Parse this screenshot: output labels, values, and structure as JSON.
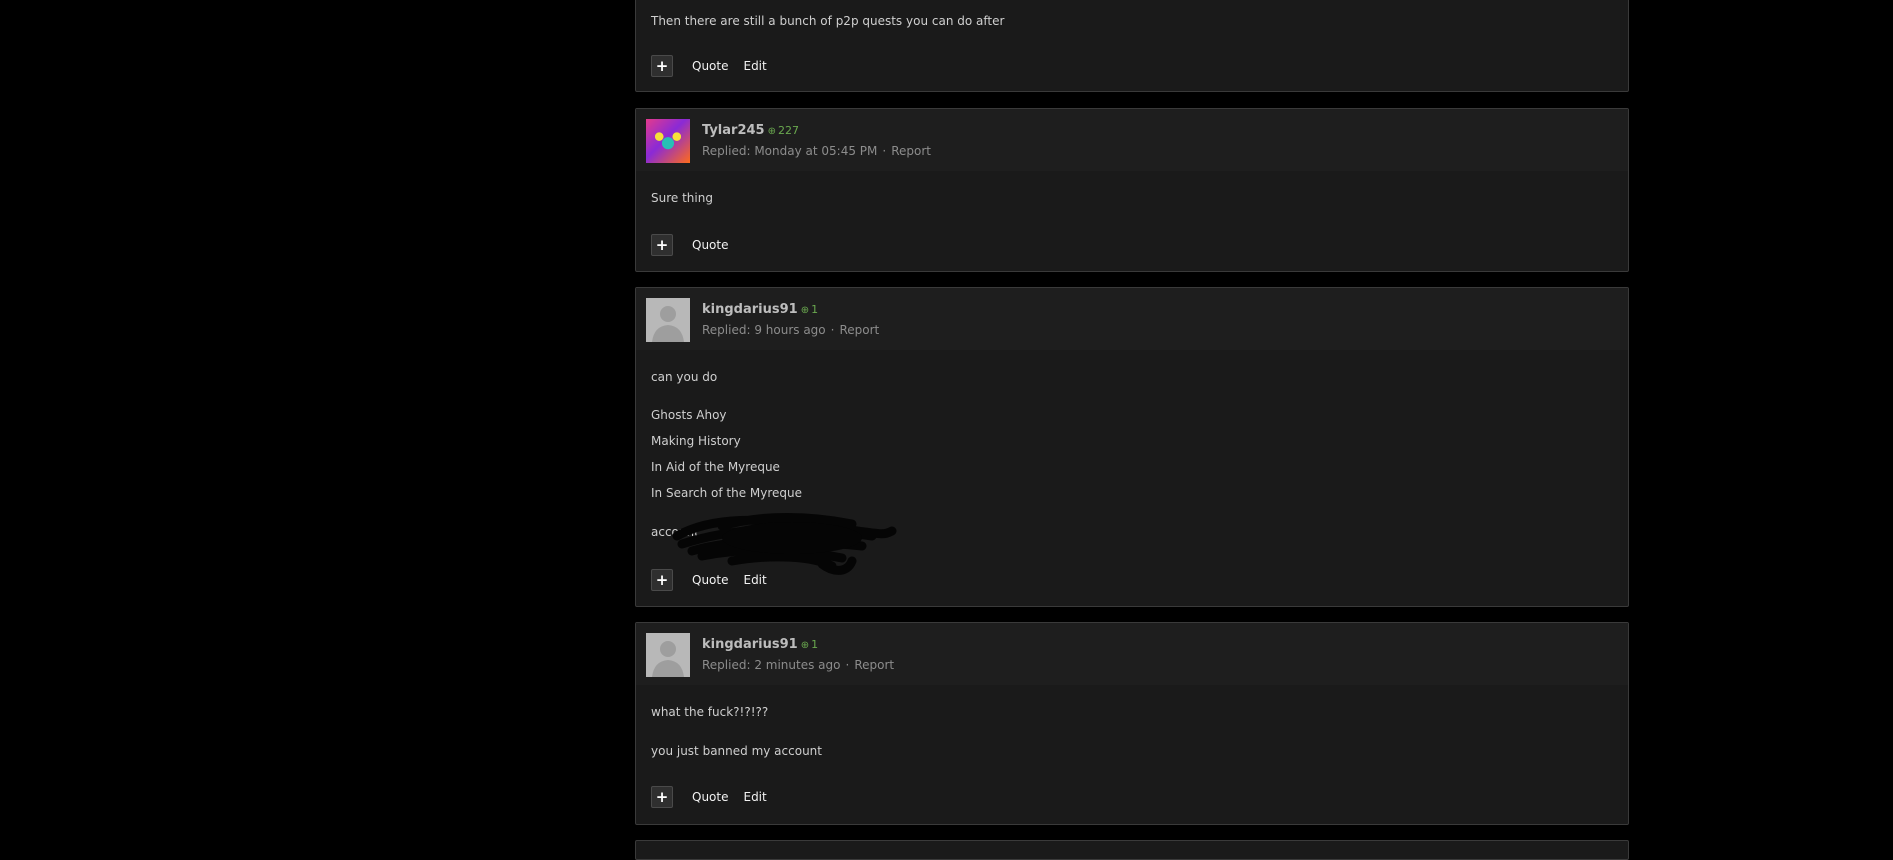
{
  "posts": [
    {
      "body": [
        "Then there are still a bunch of p2p quests you can do after"
      ],
      "actions": {
        "plus": "+",
        "quote": "Quote",
        "edit": "Edit"
      }
    },
    {
      "username": "Tylar245",
      "rep": "227",
      "replied": "Replied:  Monday at 05:45 PM",
      "report": "Report",
      "body": [
        "Sure thing"
      ],
      "actions": {
        "plus": "+",
        "quote": "Quote"
      }
    },
    {
      "username": "kingdarius91",
      "rep": "1",
      "replied": "Replied:  9 hours ago",
      "report": "Report",
      "body": [
        "can you do",
        "Ghosts Ahoy",
        "Making History",
        "In Aid of the Myreque",
        "In Search of the Myreque",
        "account"
      ],
      "actions": {
        "plus": "+",
        "quote": "Quote",
        "edit": "Edit"
      }
    },
    {
      "username": "kingdarius91",
      "rep": "1",
      "replied": "Replied:  2 minutes ago",
      "report": "Report",
      "body": [
        "what the fuck?!?!??",
        "you just banned my account"
      ],
      "actions": {
        "plus": "+",
        "quote": "Quote",
        "edit": "Edit"
      }
    }
  ],
  "icons": {
    "rep": "rep-circle-icon",
    "avatar_default": "default-avatar-icon"
  },
  "colors": {
    "background": "#000000",
    "post_bg": "#1a1a1a",
    "rep_green": "#6aa84f"
  }
}
